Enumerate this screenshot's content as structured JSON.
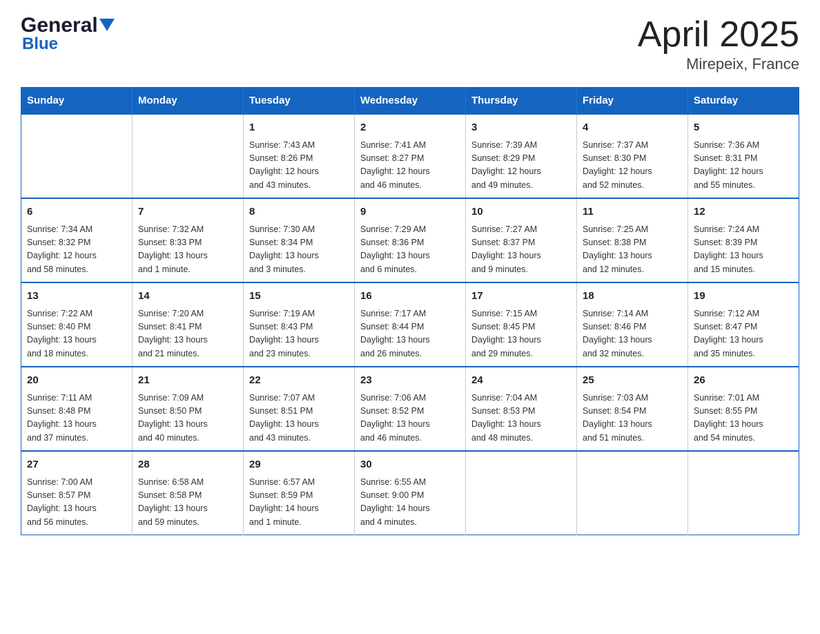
{
  "header": {
    "logo": {
      "general": "General",
      "blue": "Blue"
    },
    "title": "April 2025",
    "subtitle": "Mirepeix, France"
  },
  "calendar": {
    "days_of_week": [
      "Sunday",
      "Monday",
      "Tuesday",
      "Wednesday",
      "Thursday",
      "Friday",
      "Saturday"
    ],
    "weeks": [
      [
        {
          "day": "",
          "info": ""
        },
        {
          "day": "",
          "info": ""
        },
        {
          "day": "1",
          "info": "Sunrise: 7:43 AM\nSunset: 8:26 PM\nDaylight: 12 hours\nand 43 minutes."
        },
        {
          "day": "2",
          "info": "Sunrise: 7:41 AM\nSunset: 8:27 PM\nDaylight: 12 hours\nand 46 minutes."
        },
        {
          "day": "3",
          "info": "Sunrise: 7:39 AM\nSunset: 8:29 PM\nDaylight: 12 hours\nand 49 minutes."
        },
        {
          "day": "4",
          "info": "Sunrise: 7:37 AM\nSunset: 8:30 PM\nDaylight: 12 hours\nand 52 minutes."
        },
        {
          "day": "5",
          "info": "Sunrise: 7:36 AM\nSunset: 8:31 PM\nDaylight: 12 hours\nand 55 minutes."
        }
      ],
      [
        {
          "day": "6",
          "info": "Sunrise: 7:34 AM\nSunset: 8:32 PM\nDaylight: 12 hours\nand 58 minutes."
        },
        {
          "day": "7",
          "info": "Sunrise: 7:32 AM\nSunset: 8:33 PM\nDaylight: 13 hours\nand 1 minute."
        },
        {
          "day": "8",
          "info": "Sunrise: 7:30 AM\nSunset: 8:34 PM\nDaylight: 13 hours\nand 3 minutes."
        },
        {
          "day": "9",
          "info": "Sunrise: 7:29 AM\nSunset: 8:36 PM\nDaylight: 13 hours\nand 6 minutes."
        },
        {
          "day": "10",
          "info": "Sunrise: 7:27 AM\nSunset: 8:37 PM\nDaylight: 13 hours\nand 9 minutes."
        },
        {
          "day": "11",
          "info": "Sunrise: 7:25 AM\nSunset: 8:38 PM\nDaylight: 13 hours\nand 12 minutes."
        },
        {
          "day": "12",
          "info": "Sunrise: 7:24 AM\nSunset: 8:39 PM\nDaylight: 13 hours\nand 15 minutes."
        }
      ],
      [
        {
          "day": "13",
          "info": "Sunrise: 7:22 AM\nSunset: 8:40 PM\nDaylight: 13 hours\nand 18 minutes."
        },
        {
          "day": "14",
          "info": "Sunrise: 7:20 AM\nSunset: 8:41 PM\nDaylight: 13 hours\nand 21 minutes."
        },
        {
          "day": "15",
          "info": "Sunrise: 7:19 AM\nSunset: 8:43 PM\nDaylight: 13 hours\nand 23 minutes."
        },
        {
          "day": "16",
          "info": "Sunrise: 7:17 AM\nSunset: 8:44 PM\nDaylight: 13 hours\nand 26 minutes."
        },
        {
          "day": "17",
          "info": "Sunrise: 7:15 AM\nSunset: 8:45 PM\nDaylight: 13 hours\nand 29 minutes."
        },
        {
          "day": "18",
          "info": "Sunrise: 7:14 AM\nSunset: 8:46 PM\nDaylight: 13 hours\nand 32 minutes."
        },
        {
          "day": "19",
          "info": "Sunrise: 7:12 AM\nSunset: 8:47 PM\nDaylight: 13 hours\nand 35 minutes."
        }
      ],
      [
        {
          "day": "20",
          "info": "Sunrise: 7:11 AM\nSunset: 8:48 PM\nDaylight: 13 hours\nand 37 minutes."
        },
        {
          "day": "21",
          "info": "Sunrise: 7:09 AM\nSunset: 8:50 PM\nDaylight: 13 hours\nand 40 minutes."
        },
        {
          "day": "22",
          "info": "Sunrise: 7:07 AM\nSunset: 8:51 PM\nDaylight: 13 hours\nand 43 minutes."
        },
        {
          "day": "23",
          "info": "Sunrise: 7:06 AM\nSunset: 8:52 PM\nDaylight: 13 hours\nand 46 minutes."
        },
        {
          "day": "24",
          "info": "Sunrise: 7:04 AM\nSunset: 8:53 PM\nDaylight: 13 hours\nand 48 minutes."
        },
        {
          "day": "25",
          "info": "Sunrise: 7:03 AM\nSunset: 8:54 PM\nDaylight: 13 hours\nand 51 minutes."
        },
        {
          "day": "26",
          "info": "Sunrise: 7:01 AM\nSunset: 8:55 PM\nDaylight: 13 hours\nand 54 minutes."
        }
      ],
      [
        {
          "day": "27",
          "info": "Sunrise: 7:00 AM\nSunset: 8:57 PM\nDaylight: 13 hours\nand 56 minutes."
        },
        {
          "day": "28",
          "info": "Sunrise: 6:58 AM\nSunset: 8:58 PM\nDaylight: 13 hours\nand 59 minutes."
        },
        {
          "day": "29",
          "info": "Sunrise: 6:57 AM\nSunset: 8:59 PM\nDaylight: 14 hours\nand 1 minute."
        },
        {
          "day": "30",
          "info": "Sunrise: 6:55 AM\nSunset: 9:00 PM\nDaylight: 14 hours\nand 4 minutes."
        },
        {
          "day": "",
          "info": ""
        },
        {
          "day": "",
          "info": ""
        },
        {
          "day": "",
          "info": ""
        }
      ]
    ]
  }
}
